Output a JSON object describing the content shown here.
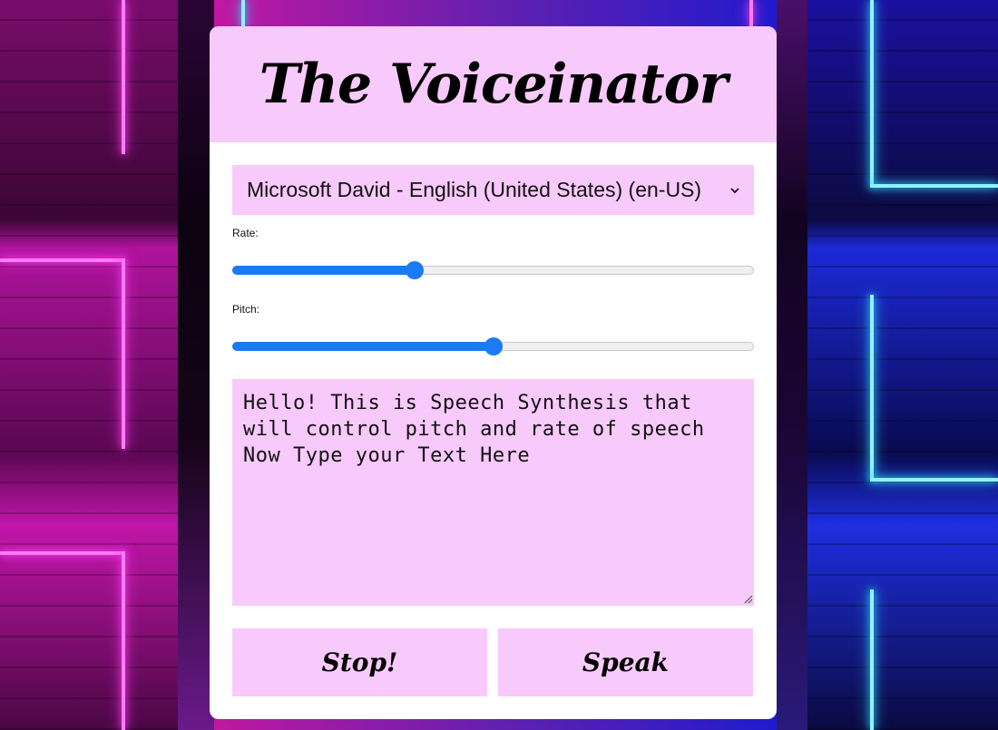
{
  "app": {
    "title": "The Voiceinator"
  },
  "voice_select": {
    "selected": "Microsoft David - English (United States) (en-US)"
  },
  "rate": {
    "label": "Rate:",
    "value": 0.35
  },
  "pitch": {
    "label": "Pitch:",
    "value": 0.5
  },
  "message": {
    "text": "Hello! This is Speech Synthesis that\nwill control pitch and rate of speech\nNow Type your Text Here"
  },
  "buttons": {
    "stop_label": "Stop!",
    "speak_label": "Speak"
  },
  "colors": {
    "accent": "#1a7bf5",
    "panel_pink": "#f8c9fb",
    "card_bg": "#ffffff"
  },
  "icons": {
    "select_arrow": "chevron-down-icon",
    "textarea_resize": "resize-handle-icon"
  }
}
